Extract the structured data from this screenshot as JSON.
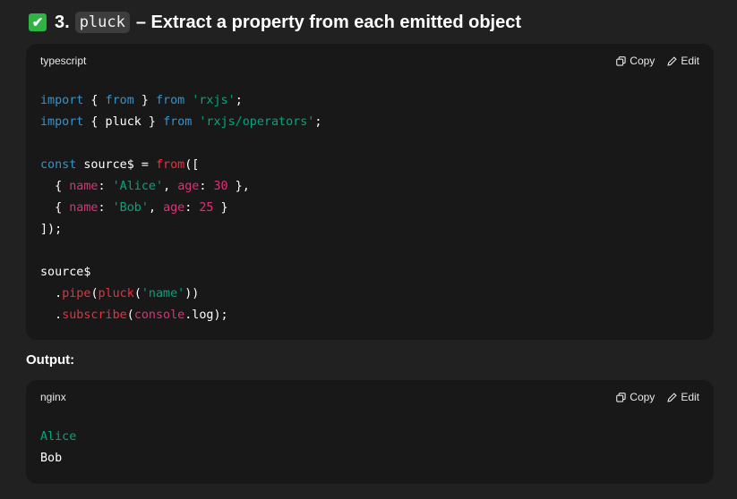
{
  "heading": {
    "number": "3.",
    "code": "pluck",
    "text": "– Extract a property from each emitted object"
  },
  "code_block_1": {
    "language": "typescript",
    "copy_label": "Copy",
    "edit_label": "Edit",
    "lines": [
      "import { from } from 'rxjs';",
      "import { pluck } from 'rxjs/operators';",
      "",
      "const source$ = from([",
      "  { name: 'Alice', age: 30 },",
      "  { name: 'Bob', age: 25 }",
      "]);",
      "",
      "source$",
      "  .pipe(pluck('name'))",
      "  .subscribe(console.log);"
    ]
  },
  "output_label": "Output:",
  "code_block_2": {
    "language": "nginx",
    "copy_label": "Copy",
    "edit_label": "Edit",
    "lines": [
      "Alice",
      "Bob"
    ]
  },
  "colors": {
    "background": "#212121",
    "code_background": "#181818",
    "keyword": "#2e95d3",
    "string": "#00a67d",
    "property": "#df3079",
    "function": "#f22c3d",
    "check": "#2fb344"
  }
}
